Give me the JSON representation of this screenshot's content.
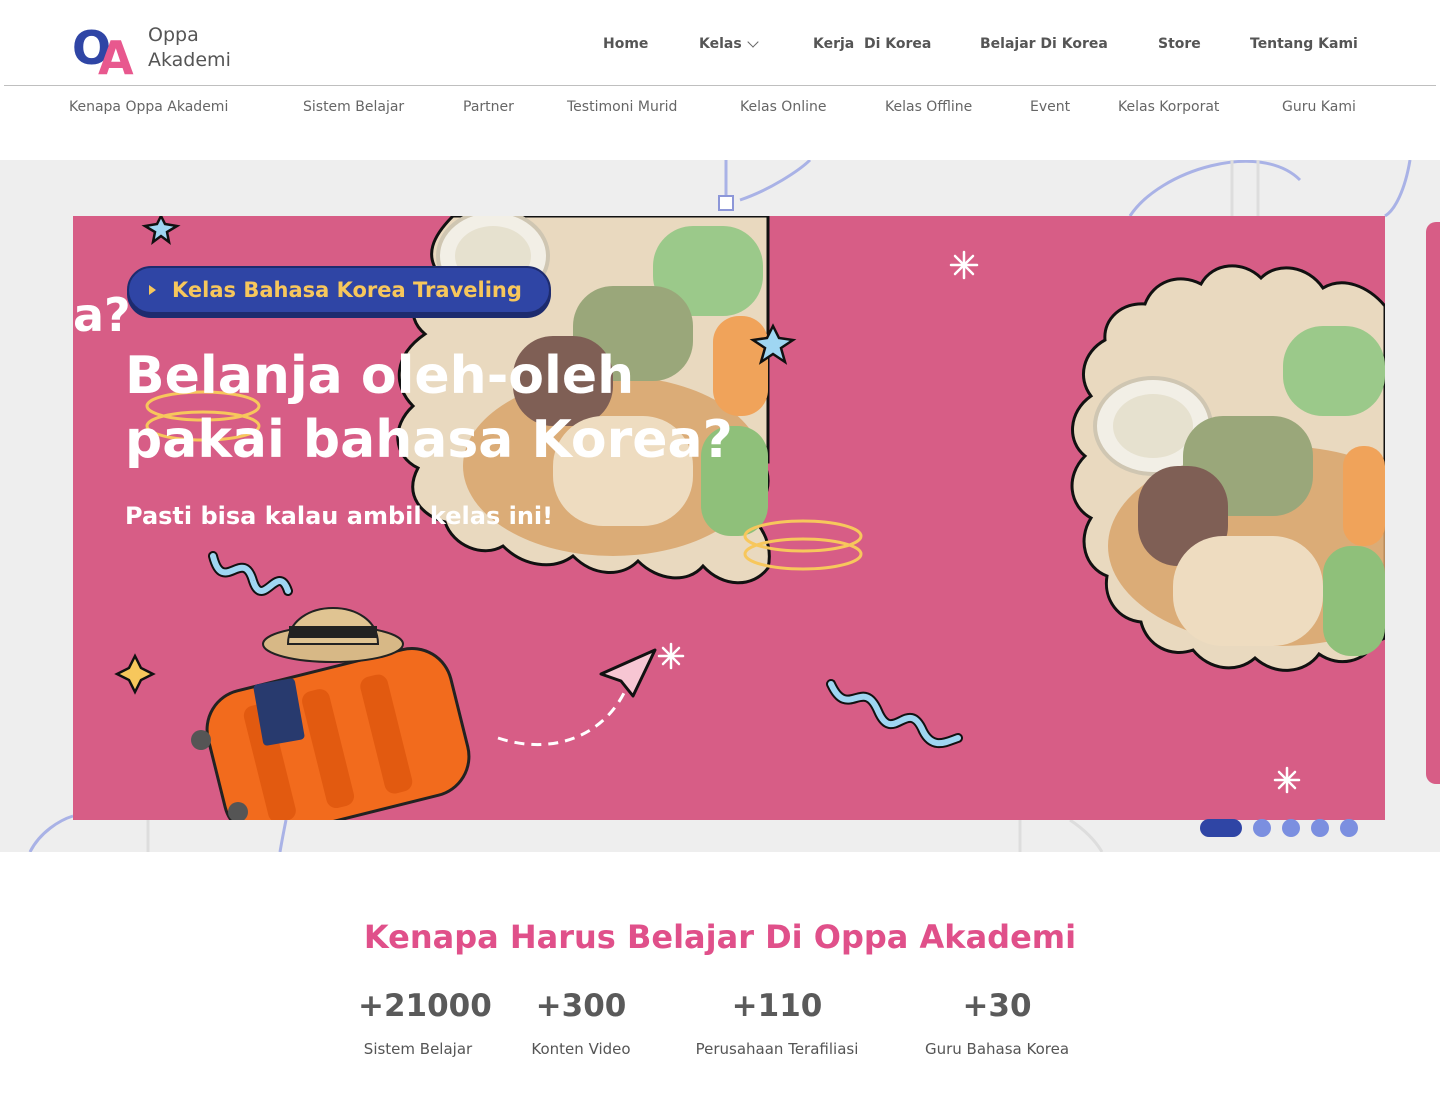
{
  "brand": {
    "initials": [
      "O",
      "A"
    ],
    "name_line1": "Oppa",
    "name_line2": "Akademi",
    "colors": {
      "blue": "#2f45a5",
      "pink": "#e8588e"
    }
  },
  "main_nav": {
    "home": "Home",
    "kelas": "Kelas",
    "kerja": "Kerja  Di Korea",
    "belajar": "Belajar Di Korea",
    "store": "Store",
    "tentang": "Tentang Kami"
  },
  "sub_nav": {
    "items": [
      "Kenapa Oppa Akademi",
      "Sistem Belajar",
      "Partner",
      "Testimoni Murid",
      "Kelas Online",
      "Kelas Offline",
      "Event",
      "Kelas Korporat",
      "Guru Kami"
    ]
  },
  "hero": {
    "tag": "Kelas Bahasa Korea Traveling",
    "title": "Belanja oleh-oleh\npakai bahasa Korea?",
    "subtitle": "Pasti bisa kalau ambil kelas ini!",
    "partial_prev": "a?",
    "slide_color": "#d75d86",
    "slides_total": 5,
    "active_slide": 1
  },
  "why": {
    "title": "Kenapa Harus Belajar Di Oppa Akademi",
    "stats": [
      {
        "value": "+21000",
        "label": "Sistem Belajar"
      },
      {
        "value": "+300",
        "label": "Konten Video"
      },
      {
        "value": "+110",
        "label": "Perusahaan Terafiliasi"
      },
      {
        "value": "+30",
        "label": "Guru Bahasa Korea"
      }
    ]
  }
}
